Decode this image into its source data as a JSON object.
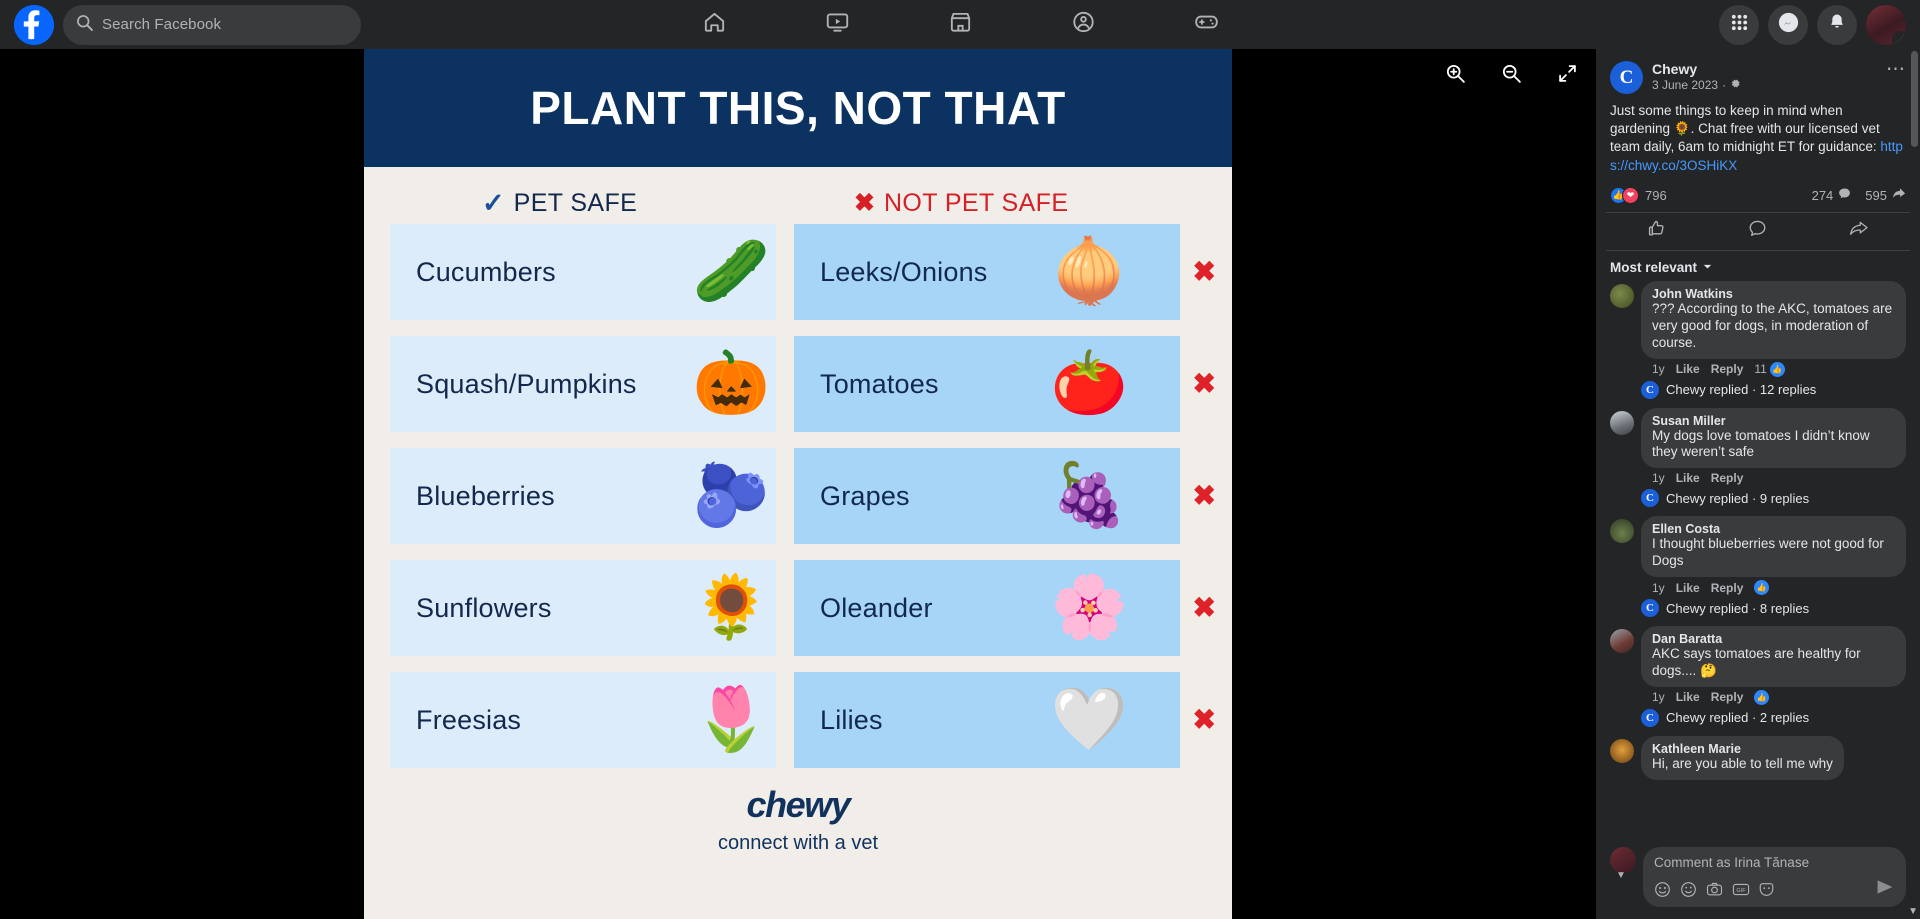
{
  "topbar": {
    "search": {
      "placeholder": "Search Facebook",
      "icon": "search-icon"
    },
    "logo_alt": "facebook-logo",
    "nav": [
      {
        "name": "home",
        "icon": "home-icon"
      },
      {
        "name": "watch",
        "icon": "video-icon"
      },
      {
        "name": "marketplace",
        "icon": "marketplace-icon"
      },
      {
        "name": "groups",
        "icon": "groups-icon"
      },
      {
        "name": "gaming",
        "icon": "gaming-icon"
      }
    ],
    "right": [
      {
        "name": "menu",
        "icon": "grid-menu-icon"
      },
      {
        "name": "messenger",
        "icon": "messenger-icon"
      },
      {
        "name": "notifications",
        "icon": "bell-icon"
      },
      {
        "name": "account",
        "icon": "avatar-icon"
      }
    ]
  },
  "viewer": {
    "controls": [
      {
        "name": "zoom-in",
        "icon": "zoom-in-icon"
      },
      {
        "name": "zoom-out",
        "icon": "zoom-out-icon"
      },
      {
        "name": "expand",
        "icon": "expand-icon"
      }
    ]
  },
  "infographic": {
    "title": "PLANT THIS, NOT THAT",
    "header_bg": "#0b3260",
    "page_bg": "#f1ede8",
    "safe_heading": "PET SAFE",
    "safe_mark": "✓",
    "unsafe_heading": "NOT PET SAFE",
    "unsafe_mark": "✖",
    "safe_color": "#12284c",
    "unsafe_color": "#d62027",
    "safe_cell_bg": "#ddecfb",
    "unsafe_cell_bg": "#a6d5f7",
    "rows": [
      {
        "safe": "Cucumbers",
        "safe_art": "🥒",
        "unsafe": "Leeks/Onions",
        "unsafe_art": "🧅"
      },
      {
        "safe": "Squash/Pumpkins",
        "safe_art": "🎃",
        "unsafe": "Tomatoes",
        "unsafe_art": "🍅"
      },
      {
        "safe": "Blueberries",
        "safe_art": "🫐",
        "unsafe": "Grapes",
        "unsafe_art": "🍇"
      },
      {
        "safe": "Sunflowers",
        "safe_art": "🌻",
        "unsafe": "Oleander",
        "unsafe_art": "🌸"
      },
      {
        "safe": "Freesias",
        "safe_art": "🌷",
        "unsafe": "Lilies",
        "unsafe_art": "🤍"
      }
    ],
    "brand_logo": "chewy",
    "brand_tagline": "connect with a vet"
  },
  "post": {
    "author": "Chewy",
    "author_initial": "C",
    "date": "3 June 2023",
    "privacy_icon": "gear-icon",
    "menu_icon": "ellipsis-icon",
    "text_before_link": "Just some things to keep in mind when gardening 🌻. Chat free with our licensed vet team daily, 6am to midnight ET for guidance: ",
    "link": "https://chwy.co/3OSHiKX",
    "reactions_count": "796",
    "comments_count": "274",
    "shares_count": "595",
    "reaction_icons": [
      "like-reaction-icon",
      "love-reaction-icon"
    ],
    "actions": [
      {
        "name": "like",
        "icon": "thumbs-up-icon"
      },
      {
        "name": "comment",
        "icon": "comment-bubble-icon"
      },
      {
        "name": "share",
        "icon": "share-arrow-icon"
      }
    ]
  },
  "comments_section": {
    "sort_label": "Most relevant",
    "sort_icon": "chevron-down-icon",
    "items": [
      {
        "name": "John Watkins",
        "text": "??? According to the AKC, tomatoes are very good for dogs, in moderation of course.",
        "time": "1y",
        "like": "Like",
        "reply": "Reply",
        "likes": "11",
        "has_likes": true,
        "replied": "Chewy replied · 12 replies"
      },
      {
        "name": "Susan Miller",
        "text": "My dogs love tomatoes I didn’t know they weren’t safe",
        "time": "1y",
        "like": "Like",
        "reply": "Reply",
        "likes": "",
        "has_likes": false,
        "replied": "Chewy replied · 9 replies"
      },
      {
        "name": "Ellen Costa",
        "text": "I thought blueberries were not good for Dogs",
        "time": "1y",
        "like": "Like",
        "reply": "Reply",
        "likes": "",
        "has_likes": true,
        "replied": "Chewy replied · 8 replies"
      },
      {
        "name": "Dan Baratta",
        "text": "AKC says tomatoes are healthy for dogs.... 🤔",
        "time": "1y",
        "like": "Like",
        "reply": "Reply",
        "likes": "",
        "has_likes": true,
        "replied": "Chewy replied · 2 replies"
      },
      {
        "name": "Kathleen Marie",
        "text": "Hi, are you able to tell me why",
        "time": "",
        "like": "",
        "reply": "",
        "likes": "",
        "has_likes": false,
        "replied": ""
      }
    ]
  },
  "composer": {
    "placeholder": "Comment as Irina Tănase",
    "icons": [
      {
        "name": "emoji",
        "icon": "emoji-icon"
      },
      {
        "name": "sticker",
        "icon": "sticker-smiley-icon"
      },
      {
        "name": "camera",
        "icon": "camera-icon"
      },
      {
        "name": "gif",
        "icon": "gif-icon"
      },
      {
        "name": "avatar-sticker",
        "icon": "avatar-mask-icon"
      }
    ],
    "send_icon": "send-arrow-icon"
  }
}
